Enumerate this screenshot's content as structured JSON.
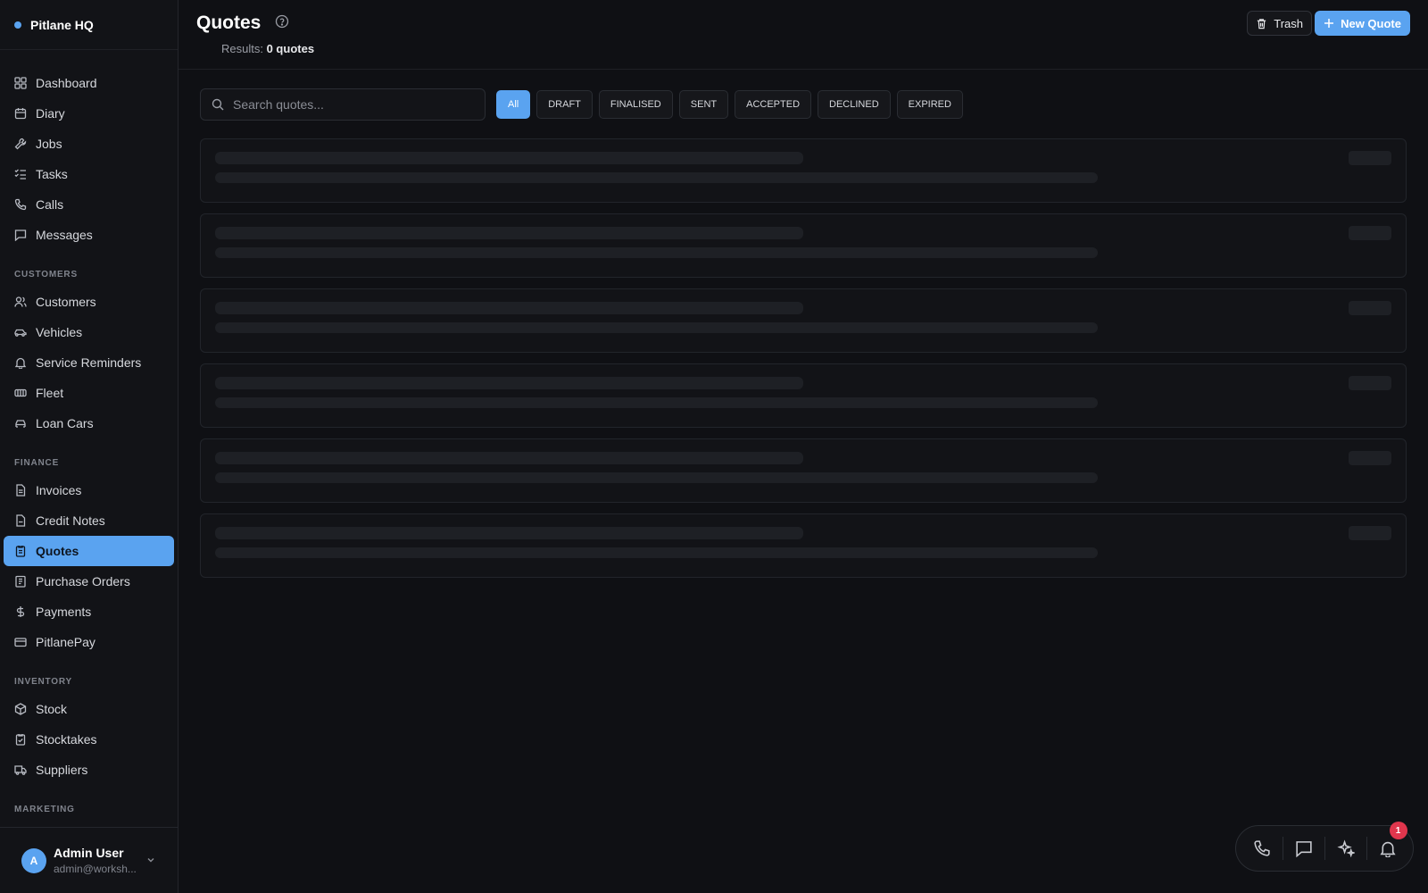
{
  "brand": {
    "name": "Pitlane HQ"
  },
  "sidebar": {
    "items_main": [
      {
        "label": "Dashboard",
        "icon": "dashboard-icon"
      },
      {
        "label": "Diary",
        "icon": "calendar-icon"
      },
      {
        "label": "Jobs",
        "icon": "wrench-icon"
      },
      {
        "label": "Tasks",
        "icon": "checklist-icon"
      },
      {
        "label": "Calls",
        "icon": "phone-icon"
      },
      {
        "label": "Messages",
        "icon": "message-icon"
      }
    ],
    "section_customers": "CUSTOMERS",
    "items_customers": [
      {
        "label": "Customers",
        "icon": "users-icon"
      },
      {
        "label": "Vehicles",
        "icon": "car-icon"
      },
      {
        "label": "Service Reminders",
        "icon": "bell-icon"
      },
      {
        "label": "Fleet",
        "icon": "fleet-icon"
      },
      {
        "label": "Loan Cars",
        "icon": "loan-car-icon"
      }
    ],
    "section_finance": "FINANCE",
    "items_finance": [
      {
        "label": "Invoices",
        "icon": "invoice-icon"
      },
      {
        "label": "Credit Notes",
        "icon": "credit-note-icon"
      },
      {
        "label": "Quotes",
        "icon": "quote-icon",
        "active": true
      },
      {
        "label": "Purchase Orders",
        "icon": "purchase-order-icon"
      },
      {
        "label": "Payments",
        "icon": "dollar-icon"
      },
      {
        "label": "PitlanePay",
        "icon": "card-icon"
      }
    ],
    "section_inventory": "INVENTORY",
    "items_inventory": [
      {
        "label": "Stock",
        "icon": "box-icon"
      },
      {
        "label": "Stocktakes",
        "icon": "clipboard-check-icon"
      },
      {
        "label": "Suppliers",
        "icon": "truck-icon"
      }
    ],
    "section_marketing": "MARKETING"
  },
  "user": {
    "initial": "A",
    "name": "Admin User",
    "email": "admin@worksh..."
  },
  "header": {
    "title": "Quotes",
    "results_label": "Results:",
    "results_value": "0 quotes",
    "trash_label": "Trash",
    "new_label": "New Quote"
  },
  "search": {
    "placeholder": "Search quotes..."
  },
  "filters": [
    "All",
    "DRAFT",
    "FINALISED",
    "SENT",
    "ACCEPTED",
    "DECLINED",
    "EXPIRED"
  ],
  "active_filter": "All",
  "notifications": {
    "count": "1"
  },
  "colors": {
    "accent": "#5aa3f0",
    "badge": "#e0364d",
    "background": "#0f1014"
  }
}
